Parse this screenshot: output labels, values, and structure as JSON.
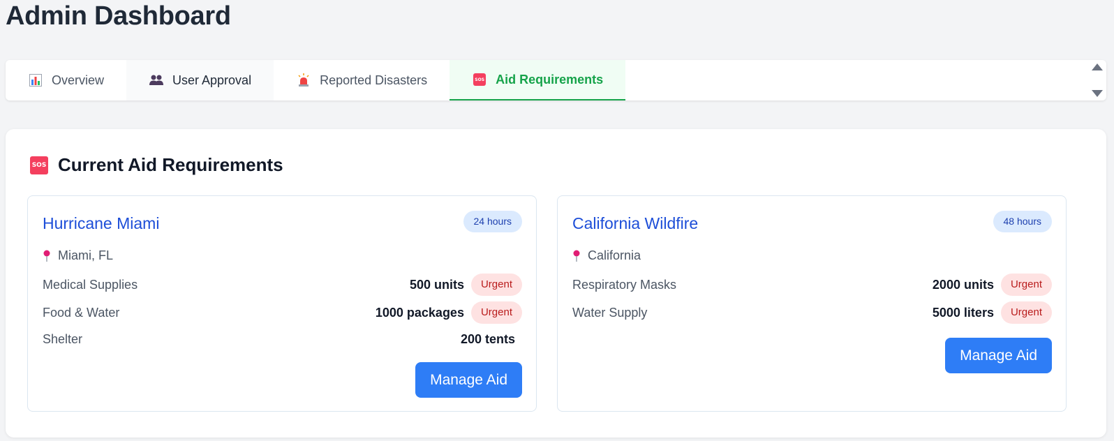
{
  "page": {
    "title": "Admin Dashboard"
  },
  "tabs": [
    {
      "label": "Overview",
      "icon": "bar-chart-icon"
    },
    {
      "label": "User Approval",
      "icon": "users-icon"
    },
    {
      "label": "Reported Disasters",
      "icon": "siren-icon"
    },
    {
      "label": "Aid Requirements",
      "icon": "sos-icon",
      "active": true
    }
  ],
  "panel": {
    "title": "Current Aid Requirements",
    "icon_text": "SOS"
  },
  "cards": [
    {
      "title": "Hurricane Miami",
      "time": "24 hours",
      "location": "Miami, FL",
      "requirements": [
        {
          "name": "Medical Supplies",
          "quantity": "500 units",
          "flag": "Urgent"
        },
        {
          "name": "Food & Water",
          "quantity": "1000 packages",
          "flag": "Urgent"
        },
        {
          "name": "Shelter",
          "quantity": "200 tents",
          "flag": ""
        }
      ],
      "button": "Manage Aid"
    },
    {
      "title": "California Wildfire",
      "time": "48 hours",
      "location": "California",
      "requirements": [
        {
          "name": "Respiratory Masks",
          "quantity": "2000 units",
          "flag": "Urgent"
        },
        {
          "name": "Water Supply",
          "quantity": "5000 liters",
          "flag": "Urgent"
        }
      ],
      "button": "Manage Aid"
    }
  ],
  "colors": {
    "accent_green": "#16a34a",
    "link_blue": "#1d4ed8",
    "button_blue": "#2e7df6",
    "urgent_bg": "#fee2e2",
    "urgent_text": "#b91c1c",
    "sos_red": "#f43f5e"
  }
}
